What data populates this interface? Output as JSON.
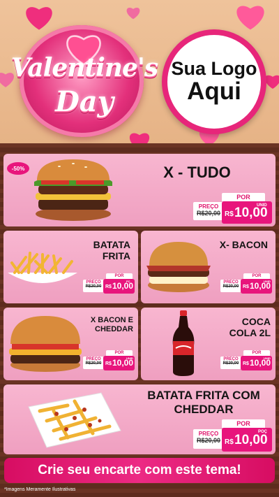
{
  "header": {
    "badge_line1": "Valentine's",
    "badge_line2": "Day",
    "logo_line1": "Sua Logo",
    "logo_line2": "Aqui"
  },
  "products": {
    "xtudo": {
      "title": "X - TUDO",
      "discount": "-50%",
      "por": "POR",
      "preco_label": "PREÇO",
      "old_price": "R$20,00",
      "currency": "R$",
      "price": "10,00",
      "unit": "UNID"
    },
    "batata": {
      "title": "BATATA FRITA",
      "por": "POR",
      "preco_label": "PREÇO",
      "old_price": "R$20,00",
      "currency": "R$",
      "price": "10,00",
      "unit": "PÇ"
    },
    "xbacon": {
      "title": "X- BACON",
      "por": "POR",
      "preco_label": "PREÇO",
      "old_price": "R$20,00",
      "currency": "R$",
      "price": "10,00",
      "unit": "UNID"
    },
    "xbaconcheddar": {
      "title": "X BACON E CHEDDAR",
      "por": "POR",
      "preco_label": "PREÇO",
      "old_price": "R$20,00",
      "currency": "R$",
      "price": "10,00",
      "unit": "UNID"
    },
    "coca": {
      "title": "COCA COLA 2L",
      "por": "POR",
      "preco_label": "PREÇO",
      "old_price": "R$20,00",
      "currency": "R$",
      "price": "10,00",
      "unit": "UNID"
    },
    "batatacheddar": {
      "title": "BATATA FRITA COM CHEDDAR",
      "por": "POR",
      "preco_label": "PREÇO",
      "old_price": "R$20,00",
      "currency": "R$",
      "price": "10,00",
      "unit": "POÇ"
    }
  },
  "cta": "Crie seu encarte com este tema!",
  "disclaimer": "*Imagens Meramente Ilustrativas",
  "colors": {
    "accent": "#e8157c",
    "card": "#f8b6d0",
    "wood": "#6b3424"
  }
}
